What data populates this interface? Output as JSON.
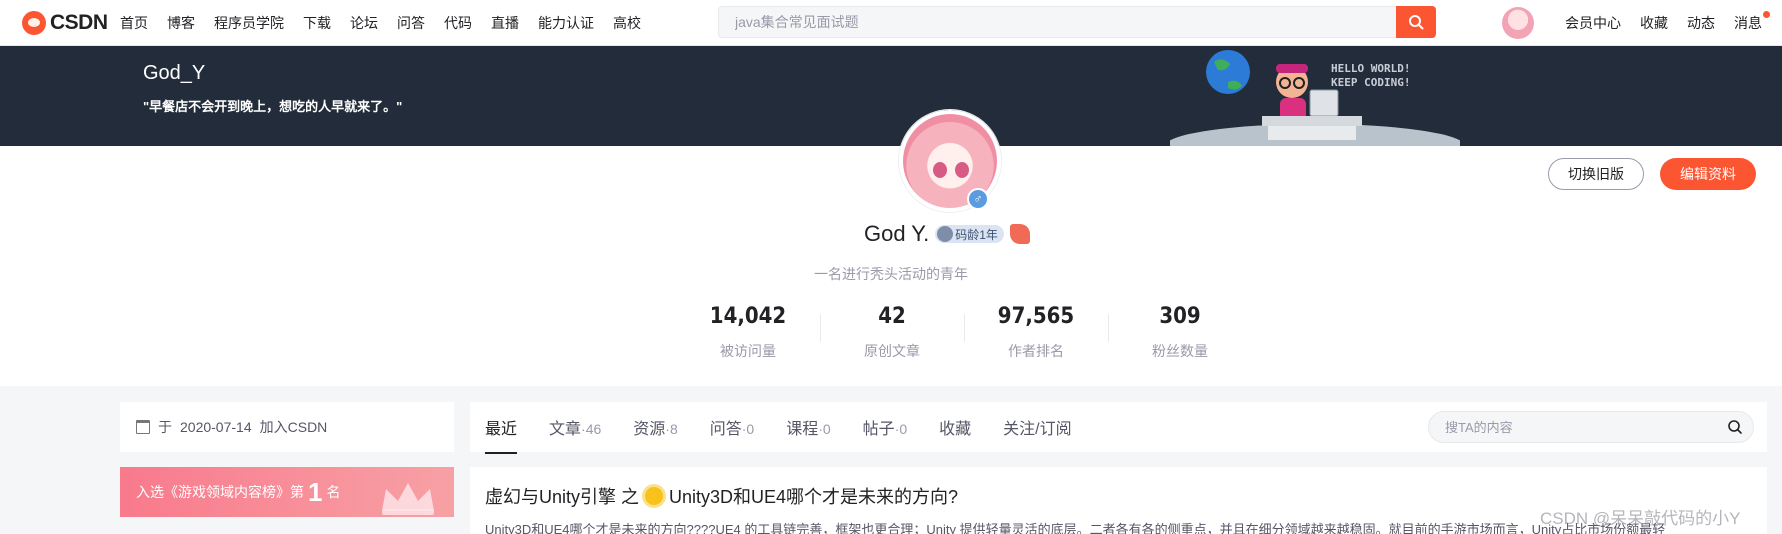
{
  "header": {
    "logo_text": "CSDN",
    "nav": [
      "首页",
      "博客",
      "程序员学院",
      "下载",
      "论坛",
      "问答",
      "代码",
      "直播",
      "能力认证",
      "高校"
    ],
    "search_placeholder": "java集合常见面试题",
    "right_menu": [
      "会员中心",
      "收藏",
      "动态",
      "消息"
    ]
  },
  "banner": {
    "name": "God_Y",
    "motto": "\"早餐店不会开到晚上，想吃的人早就来了。\"",
    "art_text_1": "HELLO WORLD!",
    "art_text_2": "KEEP CODING!"
  },
  "profile": {
    "switch_label": "切换旧版",
    "edit_label": "编辑资料",
    "nickname": "God Y.",
    "code_age": "码龄1年",
    "gender_symbol": "♂",
    "signature": "一名进行秃头活动的青年",
    "stats": [
      {
        "value": "14,042",
        "label": "被访问量"
      },
      {
        "value": "42",
        "label": "原创文章"
      },
      {
        "value": "97,565",
        "label": "作者排名"
      },
      {
        "value": "309",
        "label": "粉丝数量"
      }
    ]
  },
  "sidebar": {
    "join_prefix": "于",
    "join_date": "2020-07-14",
    "join_suffix": "加入CSDN",
    "rank_prefix": "入选《游戏领域内容榜》第",
    "rank_num": "1",
    "rank_suffix": "名"
  },
  "tabs": [
    {
      "label": "最近",
      "count": ""
    },
    {
      "label": "文章",
      "count": "·46"
    },
    {
      "label": "资源",
      "count": "·8"
    },
    {
      "label": "问答",
      "count": "·0"
    },
    {
      "label": "课程",
      "count": "·0"
    },
    {
      "label": "帖子",
      "count": "·0"
    },
    {
      "label": "收藏",
      "count": ""
    },
    {
      "label": "关注/订阅",
      "count": ""
    }
  ],
  "tab_search_placeholder": "搜TA的内容",
  "article": {
    "title_1": "虚幻与Unity引擎 之",
    "title_2": "Unity3D和UE4哪个才是未来的方向?",
    "desc": "Unity3D和UE4哪个才是未来的方向????UE4 的工具链完善，框架也更合理；Unity 提供轻量灵活的底层。二者各有各的侧重点，并且在细分领域越来越稳固。就目前的手游市场而言，Unity占比市场份额最轻"
  },
  "watermark": "CSDN @呆呆敲代码的小Y",
  "colors": {
    "brand": "#fc5531",
    "banner_bg": "#222c3a",
    "rank_bg": "#f87a8c"
  }
}
